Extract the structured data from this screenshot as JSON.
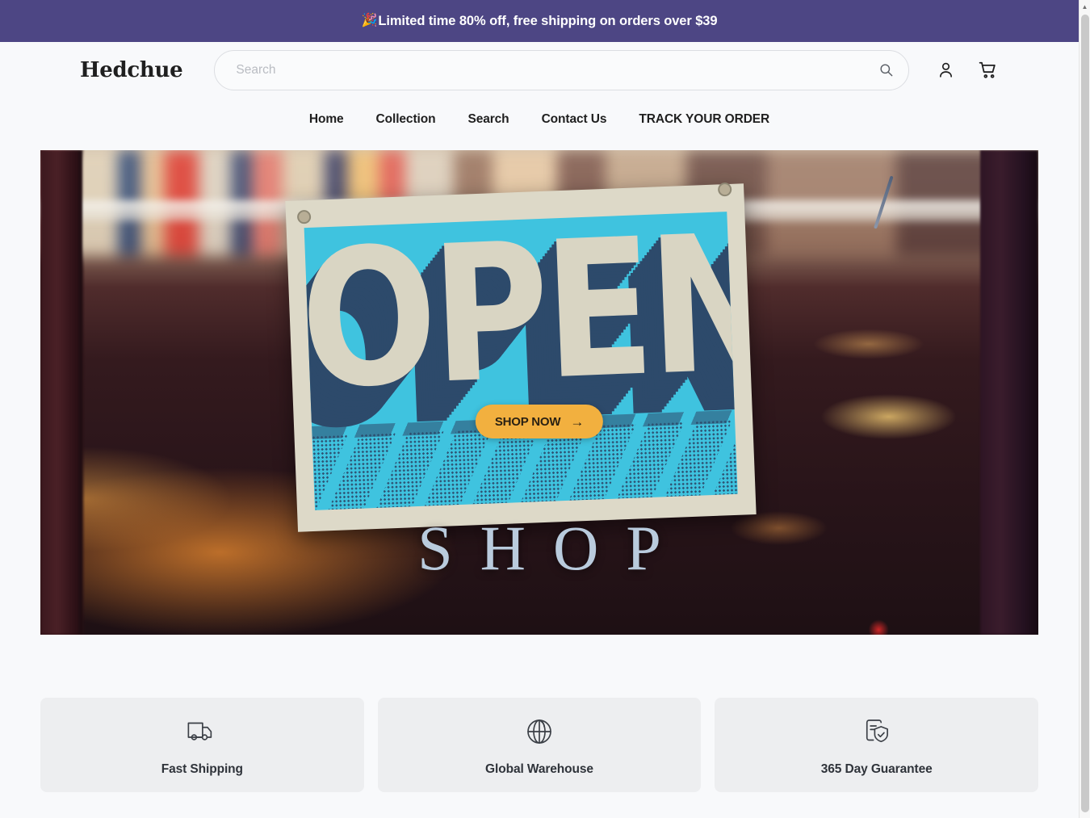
{
  "announcement": {
    "emoji": "🎉",
    "text": "Limited time 80% off, free shipping on orders over $39",
    "background": "#4d4684",
    "color": "#ffffff"
  },
  "header": {
    "logo": "Hedchue",
    "search": {
      "placeholder": "Search",
      "value": "",
      "button_icon": "search-icon"
    },
    "icons": [
      {
        "name": "account-icon",
        "label": "Account"
      },
      {
        "name": "cart-icon",
        "label": "Cart"
      }
    ]
  },
  "nav": {
    "items": [
      {
        "label": "Home"
      },
      {
        "label": "Collection"
      },
      {
        "label": "Search"
      },
      {
        "label": "Contact Us"
      },
      {
        "label": "TRACK YOUR ORDER"
      }
    ]
  },
  "hero": {
    "sign_text": "OPEN",
    "overlay_word": "SHOP",
    "cta": {
      "label": "SHOP NOW",
      "arrow": "→",
      "background": "#f2b03f",
      "color": "#2a2113"
    },
    "sign_background": "#3fc3df",
    "sign_board": "#ddd9c8",
    "sign_shadow": "#2d4a6b"
  },
  "value_props": [
    {
      "icon": "delivery-truck-icon",
      "label": "Fast Shipping"
    },
    {
      "icon": "globe-icon",
      "label": "Global Warehouse"
    },
    {
      "icon": "document-shield-check-icon",
      "label": "365 Day Guarantee"
    }
  ],
  "scrollbar": {
    "up_arrow": "▲"
  }
}
